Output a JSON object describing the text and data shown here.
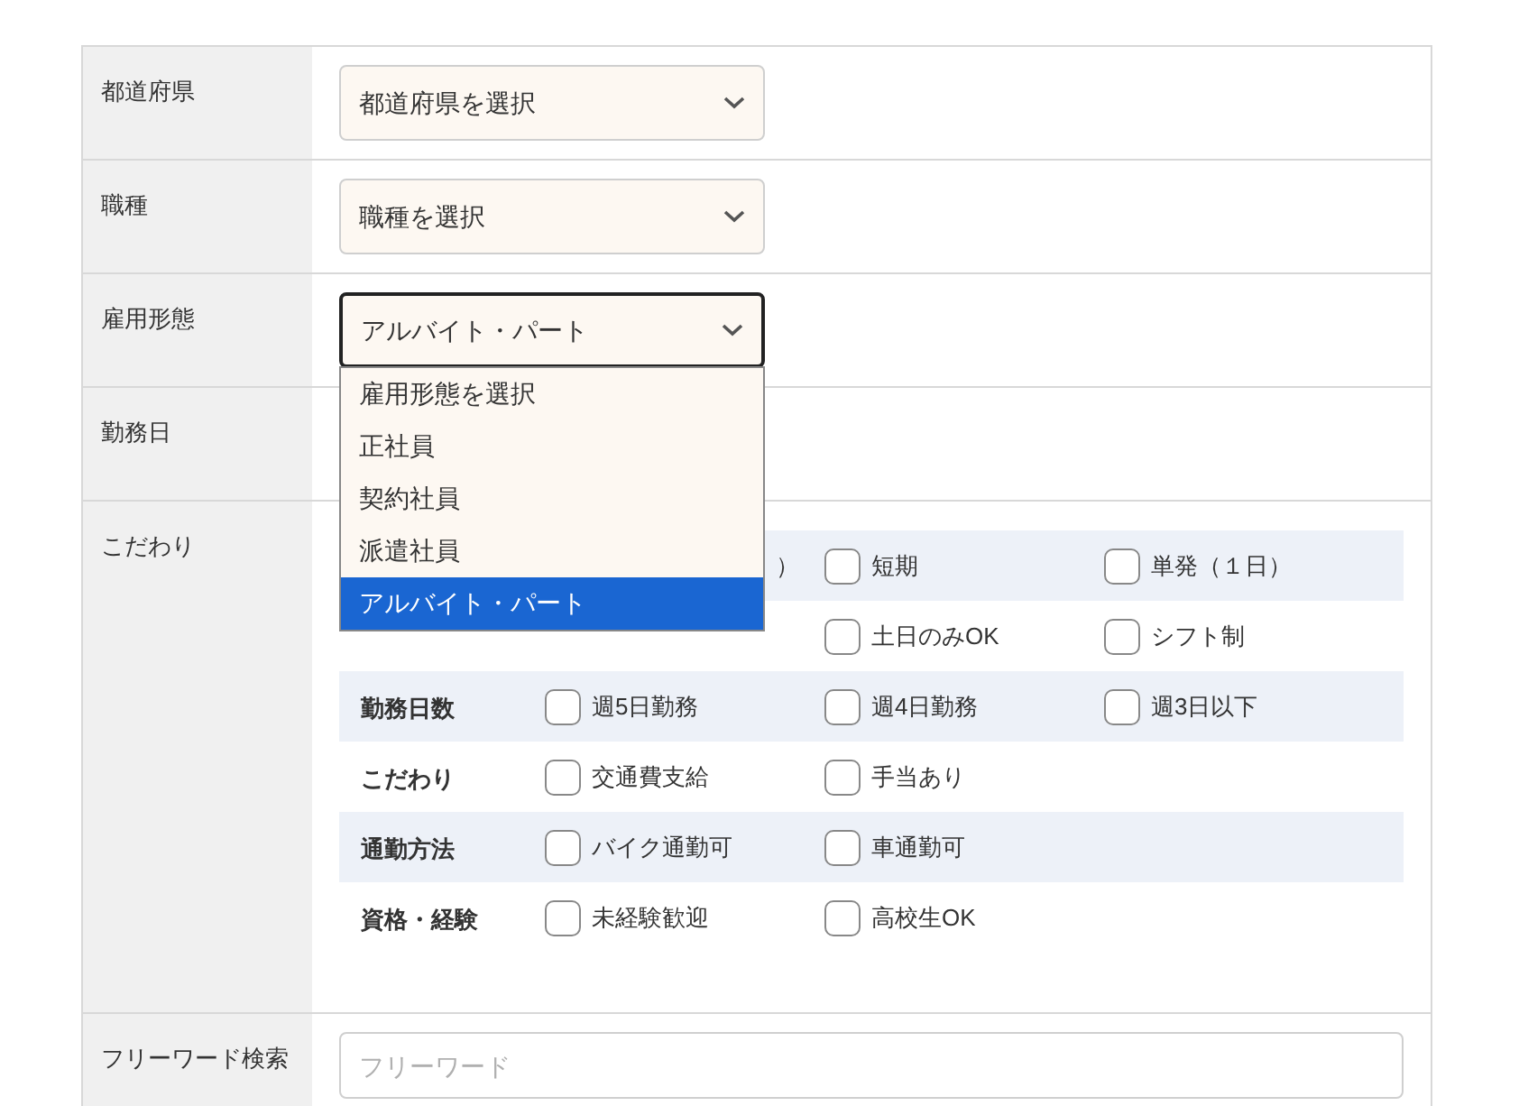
{
  "fields": [
    {
      "label": "都道府県",
      "kind": "select",
      "value": "都道府県を選択",
      "open": false
    },
    {
      "label": "職種",
      "kind": "select",
      "value": "職種を選択",
      "open": false
    },
    {
      "label": "雇用形態",
      "kind": "select",
      "value": "アルバイト・パート",
      "open": true,
      "options": [
        {
          "label": "雇用形態を選択",
          "selected": false
        },
        {
          "label": "正社員",
          "selected": false
        },
        {
          "label": "契約社員",
          "selected": false
        },
        {
          "label": "派遣社員",
          "selected": false
        },
        {
          "label": "アルバイト・パート",
          "selected": true
        }
      ]
    },
    {
      "label": "勤務日",
      "kind": "blank"
    },
    {
      "label": "こだわり",
      "kind": "checks",
      "groups": [
        {
          "options": [
            {
              "label": "）",
              "kind": "covered"
            },
            {
              "label": "短期",
              "kind": "box",
              "checked": false
            },
            {
              "label": "単発（１日）",
              "kind": "box",
              "checked": false
            }
          ]
        },
        {
          "options": [
            {
              "kind": "gap"
            },
            {
              "label": "土日のみOK",
              "kind": "box",
              "checked": false
            },
            {
              "label": "シフト制",
              "kind": "box",
              "checked": false
            }
          ]
        },
        {
          "label": "勤務日数",
          "options": [
            {
              "label": "週5日勤務",
              "kind": "box",
              "checked": false
            },
            {
              "label": "週4日勤務",
              "kind": "box",
              "checked": false
            },
            {
              "label": "週3日以下",
              "kind": "box",
              "checked": false
            }
          ]
        },
        {
          "label": "こだわり",
          "options": [
            {
              "label": "交通費支給",
              "kind": "box",
              "checked": false
            },
            {
              "label": "手当あり",
              "kind": "box",
              "checked": false
            }
          ]
        },
        {
          "label": "通勤方法",
          "options": [
            {
              "label": "バイク通勤可",
              "kind": "box",
              "checked": false
            },
            {
              "label": "車通勤可",
              "kind": "box",
              "checked": false
            }
          ]
        },
        {
          "label": "資格・経験",
          "options": [
            {
              "label": "未経験歓迎",
              "kind": "box",
              "checked": false
            },
            {
              "label": "高校生OK",
              "kind": "box",
              "checked": false
            }
          ]
        }
      ]
    },
    {
      "label": "フリーワード検索",
      "kind": "text",
      "placeholder": "フリーワード"
    }
  ]
}
